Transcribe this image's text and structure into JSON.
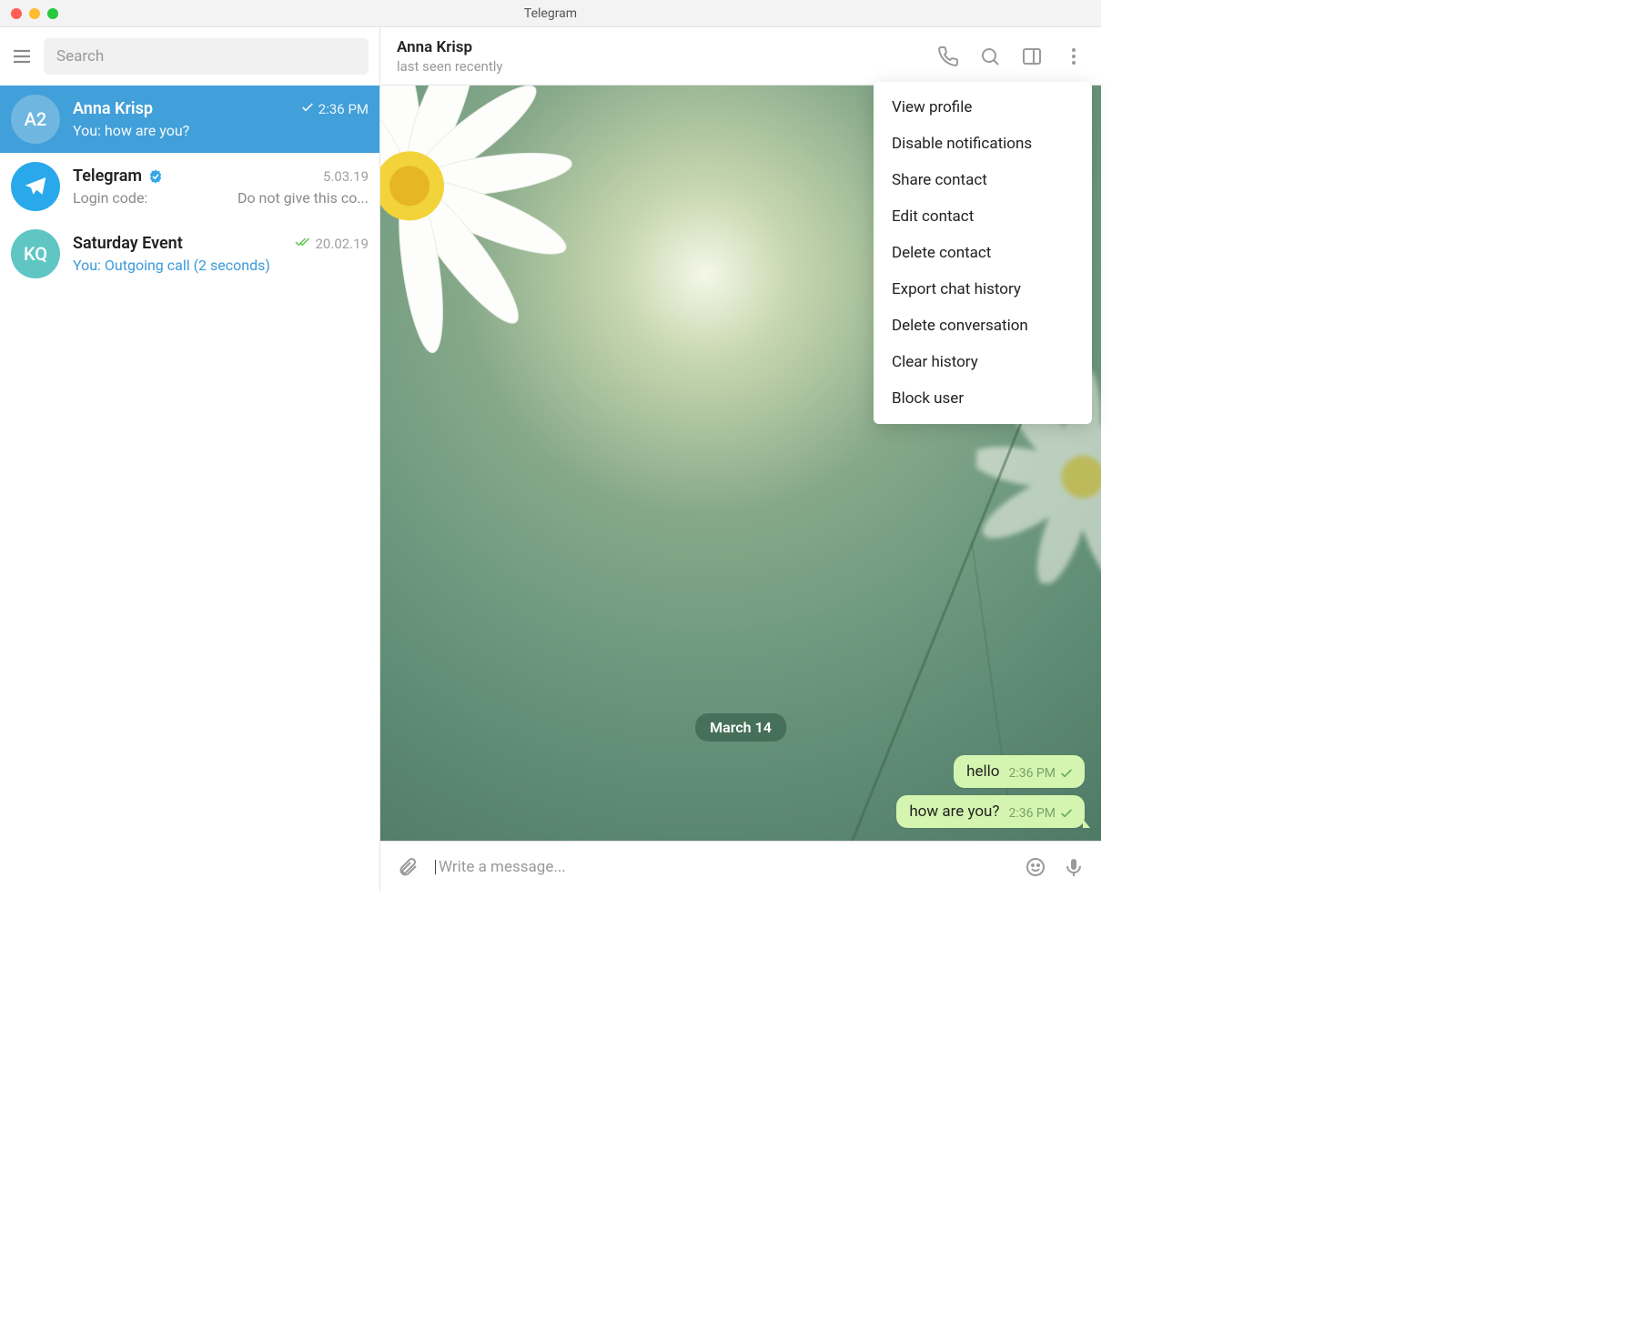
{
  "window": {
    "title": "Telegram"
  },
  "sidebar": {
    "search_placeholder": "Search",
    "chats": [
      {
        "avatar_text": "A2",
        "avatar_bg": "#6fb7e0",
        "name": "Anna Krisp",
        "time": "2:36 PM",
        "check": true,
        "preview": "You: how are you?",
        "active": true,
        "verified": false
      },
      {
        "avatar_text": "",
        "avatar_bg": "#29a9eb",
        "avatar_type": "telegram",
        "name": "Telegram",
        "time": "5.03.19",
        "check": false,
        "preview_a": "Login code:",
        "preview_b": "Do not give this co...",
        "active": false,
        "verified": true
      },
      {
        "avatar_text": "KQ",
        "avatar_bg": "#5fc6c4",
        "name": "Saturday Event",
        "time": "20.02.19",
        "double_check": true,
        "preview": "You: Outgoing call (2 seconds)",
        "preview_link": true,
        "active": false,
        "verified": false
      }
    ]
  },
  "chat_header": {
    "name": "Anna Krisp",
    "status": "last seen recently"
  },
  "dropdown": [
    "View profile",
    "Disable notifications",
    "Share contact",
    "Edit contact",
    "Delete contact",
    "Export chat history",
    "Delete conversation",
    "Clear history",
    "Block user"
  ],
  "chat": {
    "date_label": "March 14",
    "messages": [
      {
        "text": "hello",
        "time": "2:36 PM"
      },
      {
        "text": "how are you?",
        "time": "2:36 PM"
      }
    ]
  },
  "compose": {
    "placeholder": "Write a message..."
  }
}
